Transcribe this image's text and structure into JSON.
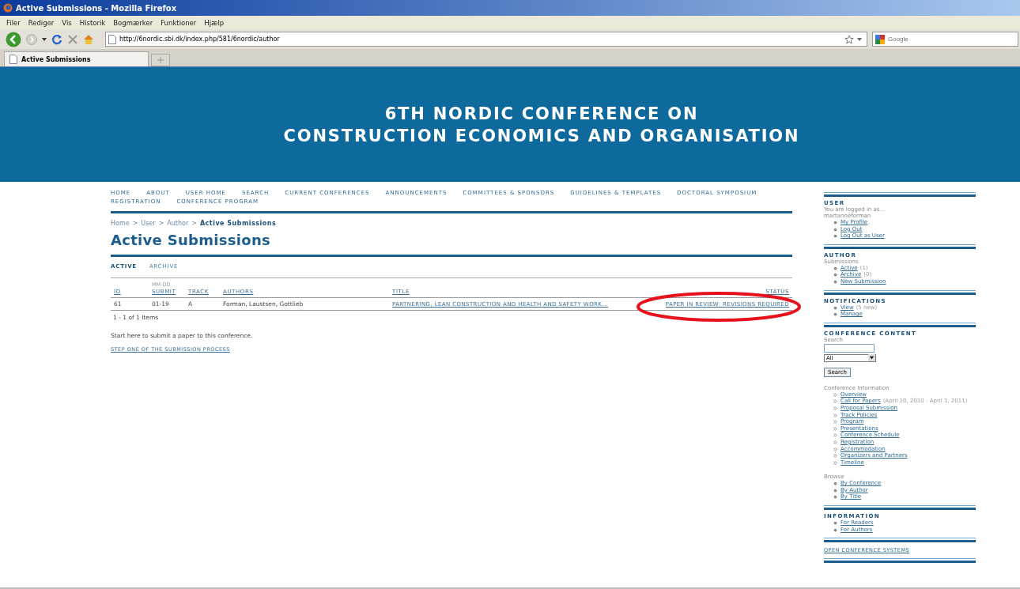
{
  "window": {
    "title": "Active Submissions - Mozilla Firefox"
  },
  "menu": [
    "Filer",
    "Rediger",
    "Vis",
    "Historik",
    "Bogmærker",
    "Funktioner",
    "Hjælp"
  ],
  "address": {
    "value": "http://6nordic.sbi.dk/index.php/581/6nordic/author"
  },
  "search": {
    "placeholder": "Google"
  },
  "tabs": [
    {
      "label": "Active Submissions",
      "selected": true
    }
  ],
  "banner": {
    "lines": [
      "6TH NORDIC CONFERENCE ON",
      "CONSTRUCTION ECONOMICS AND ORGANISATION"
    ]
  },
  "nav": [
    "HOME",
    "ABOUT",
    "USER HOME",
    "SEARCH",
    "CURRENT CONFERENCES",
    "ANNOUNCEMENTS",
    "COMMITTEES & SPONSORS",
    "GUIDELINES & TEMPLATES",
    "DOCTORAL SYMPOSIUM",
    "REGISTRATION",
    "CONFERENCE PROGRAM"
  ],
  "breadcrumb": {
    "links": [
      "Home",
      "User",
      "Author"
    ],
    "separator": ">",
    "current": "Active Submissions"
  },
  "heading": "Active Submissions",
  "subtabs": [
    {
      "label": "ACTIVE",
      "selected": true
    },
    {
      "label": "ARCHIVE",
      "selected": false
    }
  ],
  "table": {
    "columns": [
      {
        "label": "ID"
      },
      {
        "over": "MM-DD",
        "label": "SUBMIT"
      },
      {
        "label": "TRACK"
      },
      {
        "label": "AUTHORS"
      },
      {
        "label": "TITLE"
      },
      {
        "label": "STATUS"
      }
    ],
    "rows": [
      {
        "id": "61",
        "submit": "01-19",
        "track": "A",
        "authors": "Forman, Laustsen, Gottlieb",
        "title": "PARTNERING, LEAN CONSTRUCTION AND HEALTH AND SAFETY WORK...",
        "status": "PAPER IN REVIEW: REVISIONS REQUIRED",
        "circled": true
      }
    ]
  },
  "pager": "1 - 1 of 1 Items",
  "intro": "Start here to submit a paper to this conference.",
  "step_link": "STEP ONE OF THE SUBMISSION PROCESS",
  "sidebar": [
    {
      "title": "USER",
      "lines": [
        "You are logged in as...",
        "martanneforman"
      ],
      "lists": [
        {
          "kind": "bullet",
          "items": [
            {
              "label": "My Profile"
            },
            {
              "label": "Log Out"
            },
            {
              "label": "Log Out as User"
            }
          ]
        }
      ]
    },
    {
      "title": "AUTHOR",
      "lines": [
        "Submissions"
      ],
      "lists": [
        {
          "kind": "bullet",
          "items": [
            {
              "label": "Active",
              "note": "(1)"
            },
            {
              "label": "Archive",
              "note": "(0)"
            },
            {
              "label": "New Submission"
            }
          ]
        }
      ]
    },
    {
      "title": "NOTIFICATIONS",
      "lists": [
        {
          "kind": "bullet",
          "items": [
            {
              "label": "View",
              "note": "(5 new)"
            },
            {
              "label": "Manage"
            }
          ]
        }
      ]
    },
    {
      "title": "CONFERENCE CONTENT",
      "search": {
        "label": "Search",
        "select": "All",
        "button": "Search"
      },
      "lists": [
        {
          "caption": "Conference Information",
          "kind": "chevron",
          "items": [
            {
              "label": "Overview"
            },
            {
              "label": "Call for Papers",
              "note": "(April 10, 2010 - April 1, 2011)"
            },
            {
              "label": "Proposal Submission"
            },
            {
              "label": "Track Policies"
            },
            {
              "label": "Program"
            },
            {
              "label": "Presentations"
            },
            {
              "label": "Conference Schedule"
            },
            {
              "label": "Registration"
            },
            {
              "label": "Accommodation"
            },
            {
              "label": "Organizers and Partners"
            },
            {
              "label": "Timeline"
            }
          ]
        },
        {
          "caption": "Browse",
          "kind": "bullet",
          "items": [
            {
              "label": "By Conference"
            },
            {
              "label": "By Author"
            },
            {
              "label": "By Title"
            }
          ]
        }
      ]
    },
    {
      "title": "INFORMATION",
      "lists": [
        {
          "kind": "bullet",
          "items": [
            {
              "label": "For Readers"
            },
            {
              "label": "For Authors"
            }
          ]
        }
      ]
    },
    {
      "link": "OPEN CONFERENCE SYSTEMS"
    }
  ]
}
